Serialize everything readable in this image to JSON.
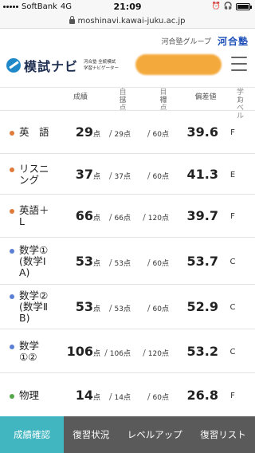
{
  "status": {
    "carrier": "SoftBank",
    "network": "4G",
    "time": "21:09"
  },
  "browser": {
    "url": "moshinavi.kawai-juku.ac.jp"
  },
  "site": {
    "group_text": "河合塾グループ",
    "brand": "河合塾",
    "app_title": "模試ナビ",
    "app_subtitle_1": "河合塾 全統模試",
    "app_subtitle_2": "学習ナビゲーター"
  },
  "table": {
    "headers": {
      "score": "成績",
      "self_1": "自己",
      "self_2": "採点",
      "goal_1": "目標",
      "goal_2": "得点",
      "deviation": "偏差値",
      "level_1": "学力",
      "level_2": "レベル"
    },
    "point_unit": "点",
    "rows": [
      {
        "subject": "英　語",
        "dot_color": "#e07a3a",
        "score": "29",
        "self": "29",
        "goal": "60",
        "deviation": "39.6",
        "level": "F"
      },
      {
        "subject": "リスニ\nング",
        "dot_color": "#e07a3a",
        "score": "37",
        "self": "37",
        "goal": "60",
        "deviation": "41.3",
        "level": "E"
      },
      {
        "subject": "英語＋\nL",
        "dot_color": "#e07a3a",
        "score": "66",
        "self": "66",
        "goal": "120",
        "deviation": "39.7",
        "level": "F"
      },
      {
        "subject": "数学①\n(数学Ⅰ\nA)",
        "dot_color": "#5b7fd6",
        "score": "53",
        "self": "53",
        "goal": "60",
        "deviation": "53.7",
        "level": "C"
      },
      {
        "subject": "数学②\n(数学Ⅱ\nB)",
        "dot_color": "#5b7fd6",
        "score": "53",
        "self": "53",
        "goal": "60",
        "deviation": "52.9",
        "level": "C"
      },
      {
        "subject": "数学\n①②",
        "dot_color": "#5b7fd6",
        "score": "106",
        "self": "106",
        "goal": "120",
        "deviation": "53.2",
        "level": "C"
      },
      {
        "subject": "物理",
        "dot_color": "#55a84a",
        "score": "14",
        "self": "14",
        "goal": "60",
        "deviation": "26.8",
        "level": "F"
      }
    ]
  },
  "nav": {
    "items": [
      "成績確認",
      "復習状況",
      "レベルアップ",
      "復習リスト"
    ],
    "active_index": 0
  },
  "colors": {
    "accent": "#41b6c0",
    "nav_bg": "#5a5a5a",
    "brand_blue": "#1c4fb8",
    "redaction": "#f4a93c"
  }
}
